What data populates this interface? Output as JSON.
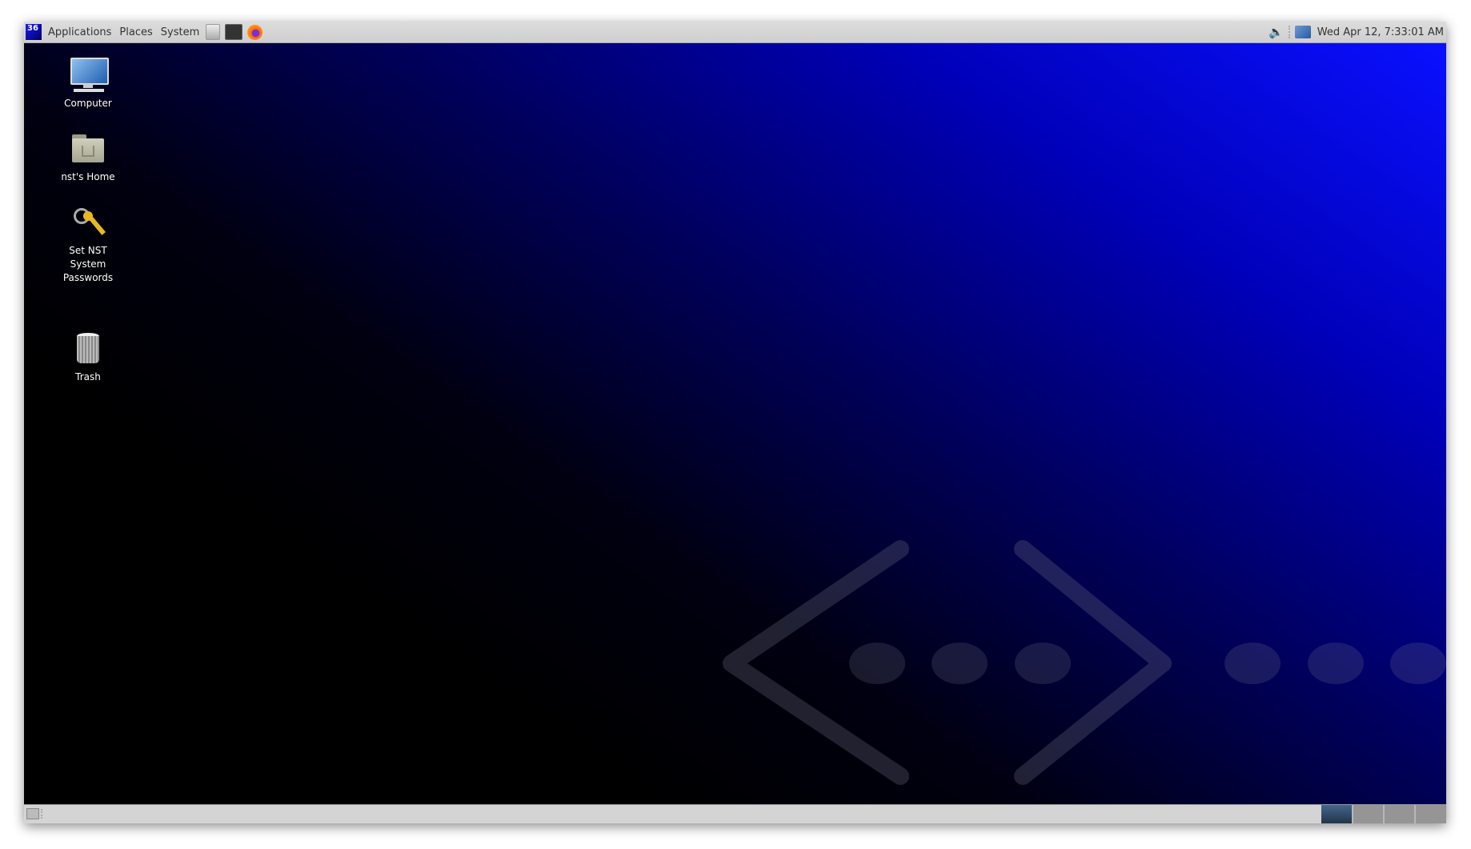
{
  "top_panel": {
    "logo_text": "36",
    "menus": [
      "Applications",
      "Places",
      "System"
    ],
    "launchers": [
      "file-cabinet-icon",
      "terminal-icon",
      "firefox-icon"
    ],
    "tray_icons": [
      "volume-icon",
      "network-icon"
    ],
    "clock": "Wed Apr 12,  7:33:01 AM"
  },
  "desktop": {
    "icons": [
      {
        "label": "Computer",
        "icon": "computer-icon"
      },
      {
        "label": "nst's Home",
        "icon": "home-folder-icon"
      },
      {
        "label": "Set NST System Passwords",
        "icon": "keys-icon"
      },
      {
        "label": "Trash",
        "icon": "trash-icon"
      }
    ]
  },
  "bottom_panel": {
    "show_desktop_icon": "show-desktop-icon",
    "workspaces": 4,
    "active_workspace": 1
  },
  "colors": {
    "wallpaper_blue": "#0a10ff",
    "panel": "#d4d4d4",
    "active_workspace": "#3a5878"
  }
}
